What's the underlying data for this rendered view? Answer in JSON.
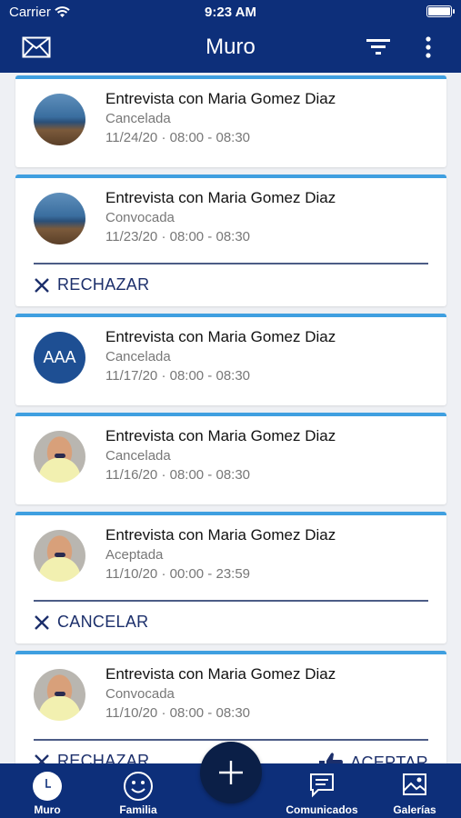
{
  "status_bar": {
    "carrier": "Carrier",
    "time": "9:23 AM"
  },
  "nav": {
    "title": "Muro",
    "left_icon": "mail-icon",
    "right_icons": [
      "filter-icon",
      "more-vertical-icon"
    ]
  },
  "colors": {
    "primary": "#0d2f7a",
    "accent": "#3f9fe0",
    "avatar_bg": "#1e4f93",
    "action_text": "#1c2f6b"
  },
  "cards": [
    {
      "title": "Entrevista con Maria Gomez Diaz",
      "status": "Cancelada",
      "date": "11/24/20 · 08:00 - 08:30"
    },
    {
      "title": "Entrevista con Maria Gomez Diaz",
      "status": "Convocada",
      "date": "11/23/20 · 08:00 - 08:30",
      "action_left": "RECHAZAR"
    },
    {
      "title": "Entrevista con Maria Gomez Diaz",
      "status": "Cancelada",
      "date": "11/17/20 · 08:00 - 08:30",
      "avatar_initials": "AAA"
    },
    {
      "title": "Entrevista con Maria Gomez Diaz",
      "status": "Cancelada",
      "date": "11/16/20 · 08:00 - 08:30"
    },
    {
      "title": "Entrevista con Maria Gomez Diaz",
      "status": "Aceptada",
      "date": "11/10/20 · 00:00 - 23:59",
      "action_left": "CANCELAR"
    },
    {
      "title": "Entrevista con Maria Gomez Diaz",
      "status": "Convocada",
      "date": "11/10/20 · 08:00 - 08:30",
      "action_left": "RECHAZAR",
      "action_right": "ACEPTAR"
    }
  ],
  "tabs": [
    {
      "label": "Muro",
      "icon": "clock-icon"
    },
    {
      "label": "Familia",
      "icon": "smiley-icon"
    },
    {
      "label": "Comunicados",
      "icon": "message-icon"
    },
    {
      "label": "Galerías",
      "icon": "gallery-icon"
    }
  ],
  "fab": {
    "icon": "plus-icon"
  }
}
